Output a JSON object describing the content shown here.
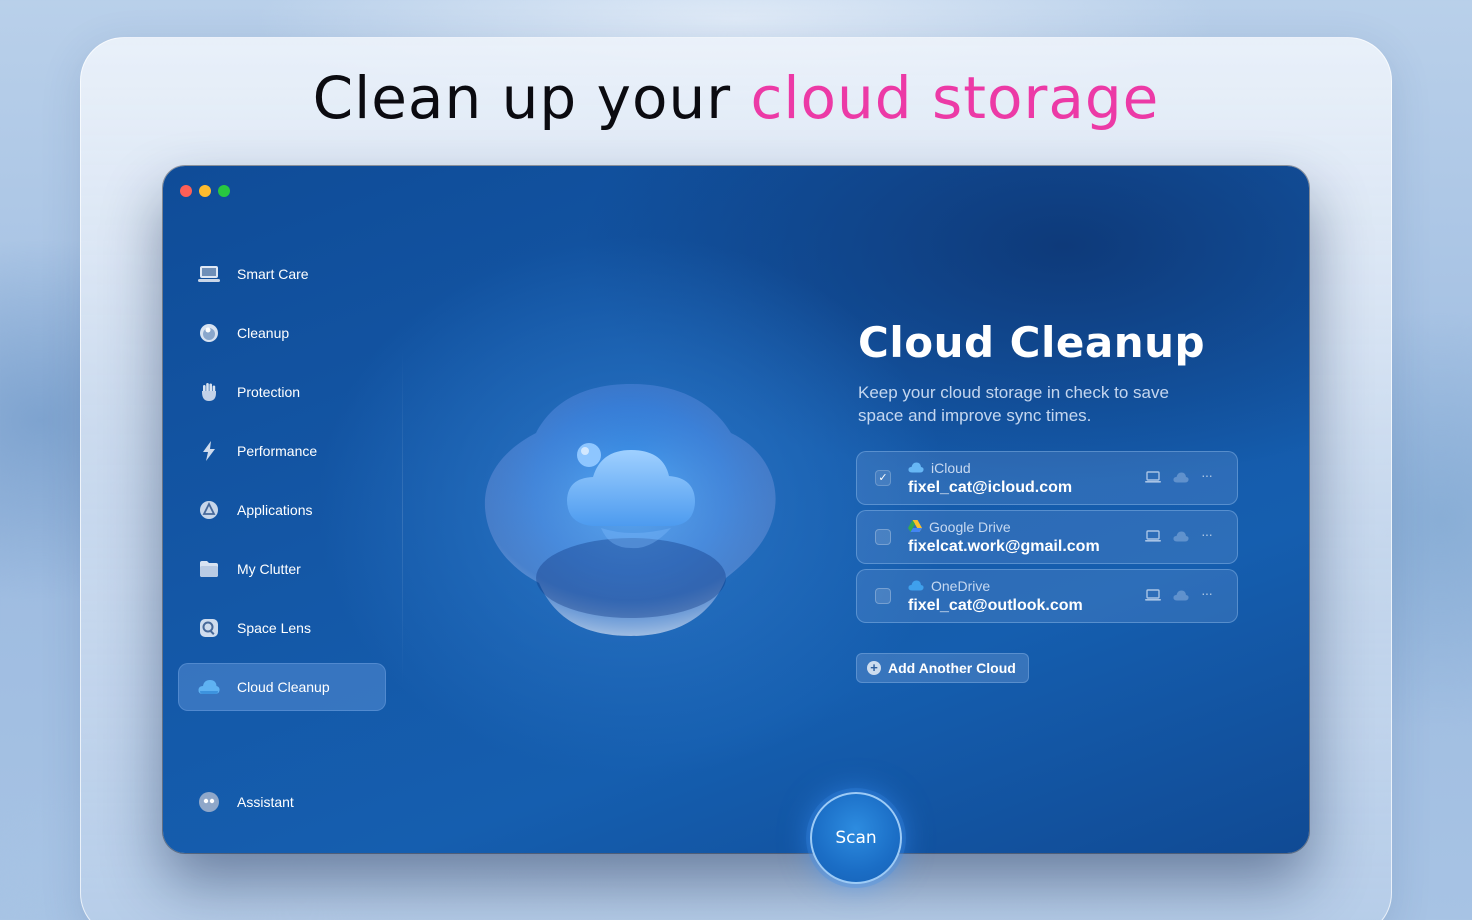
{
  "headline": {
    "prefix": "Clean up your ",
    "accent": "cloud storage"
  },
  "sidebar": {
    "items": [
      {
        "label": "Smart Care",
        "icon": "monitor-icon"
      },
      {
        "label": "Cleanup",
        "icon": "cleanup-ball-icon"
      },
      {
        "label": "Protection",
        "icon": "hand-icon"
      },
      {
        "label": "Performance",
        "icon": "lightning-icon"
      },
      {
        "label": "Applications",
        "icon": "applications-icon"
      },
      {
        "label": "My Clutter",
        "icon": "folder-icon"
      },
      {
        "label": "Space Lens",
        "icon": "lens-icon"
      },
      {
        "label": "Cloud Cleanup",
        "icon": "cloud-icon",
        "active": true
      }
    ],
    "assistant": {
      "label": "Assistant",
      "icon": "assistant-icon"
    }
  },
  "main": {
    "title": "Cloud Cleanup",
    "description": "Keep your cloud storage in check to save space and improve sync times.",
    "clouds": [
      {
        "provider": "iCloud",
        "account": "fixel_cat@icloud.com",
        "checked": true,
        "icon": "icloud-icon"
      },
      {
        "provider": "Google Drive",
        "account": "fixelcat.work@gmail.com",
        "checked": false,
        "icon": "google-drive-icon"
      },
      {
        "provider": "OneDrive",
        "account": "fixel_cat@outlook.com",
        "checked": false,
        "icon": "onedrive-icon"
      }
    ],
    "add_cloud_label": "Add Another Cloud",
    "scan_label": "Scan"
  },
  "colors": {
    "accent": "#ec3aa6",
    "window_bg": "#1457a6",
    "traffic_close": "#fe5f57",
    "traffic_min": "#febc2e",
    "traffic_max": "#28c840"
  }
}
